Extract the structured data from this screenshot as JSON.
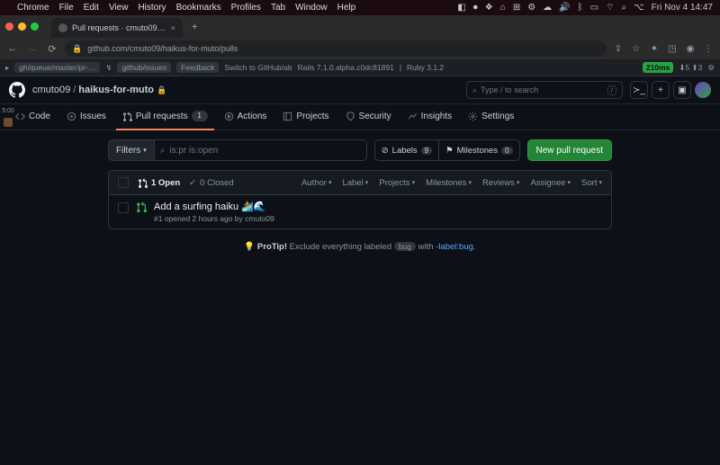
{
  "mac": {
    "menus": [
      "Chrome",
      "File",
      "Edit",
      "View",
      "History",
      "Bookmarks",
      "Profiles",
      "Tab",
      "Window",
      "Help"
    ],
    "clock": "Fri Nov 4  14:47"
  },
  "browser": {
    "tab_title": "Pull requests · cmuto09/haik…",
    "url": "github.com/cmuto09/haikus-for-muto/pulls"
  },
  "devbar": {
    "chips": [
      "gh/queue/master/pr-…",
      "github/issues",
      "Feedback"
    ],
    "switch_text": "Switch to GitHub/ab",
    "rails": "Rails 7.1.0.alpha.c0dc81891",
    "ruby": "Ruby 3.1.2",
    "timing": "210ms",
    "timing_extra": "⬇5 ⬆3"
  },
  "header": {
    "owner": "cmuto09",
    "repo": "haikus-for-muto",
    "search_placeholder": "Type / to search"
  },
  "repo_nav": {
    "code": "Code",
    "issues": "Issues",
    "pulls": "Pull requests",
    "pulls_count": "1",
    "actions": "Actions",
    "projects": "Projects",
    "security": "Security",
    "insights": "Insights",
    "settings": "Settings"
  },
  "toolbar": {
    "filters_label": "Filters",
    "search_value": "is:pr is:open",
    "labels": "Labels",
    "labels_count": "9",
    "milestones": "Milestones",
    "milestones_count": "0",
    "new_pr": "New pull request"
  },
  "list": {
    "open_count": "1 Open",
    "closed_count": "0 Closed",
    "sorts": [
      "Author",
      "Label",
      "Projects",
      "Milestones",
      "Reviews",
      "Assignee",
      "Sort"
    ],
    "pr": {
      "title": "Add a surfing haiku 🏄🌊",
      "meta": "#1 opened 2 hours ago by cmuto09"
    }
  },
  "protip": {
    "lead": "ProTip!",
    "body": "Exclude everything labeled",
    "tag": "bug",
    "with": "with",
    "link": "-label:bug"
  },
  "gutter_time": "5:00"
}
